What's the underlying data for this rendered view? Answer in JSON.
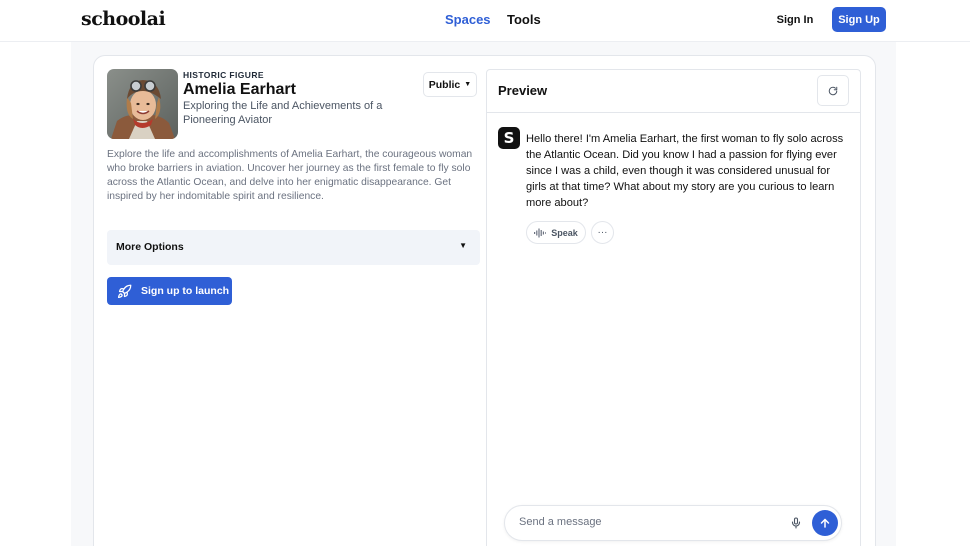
{
  "header": {
    "logo": "schoolai",
    "nav": {
      "spaces": "Spaces",
      "tools": "Tools"
    },
    "sign_in": "Sign In",
    "sign_up": "Sign Up"
  },
  "space": {
    "kicker": "HISTORIC FIGURE",
    "title": "Amelia Earhart",
    "subtitle": "Exploring the Life and Achievements of a Pioneering Aviator",
    "visibility": "Public",
    "description": "Explore the life and accomplishments of Amelia Earhart, the courageous woman who broke barriers in aviation. Uncover her journey as the first female to fly solo across the Atlantic Ocean, and delve into her enigmatic disappearance. Get inspired by her indomitable spirit and resilience.",
    "more_options": "More Options",
    "launch": "Sign up to launch"
  },
  "preview": {
    "title": "Preview",
    "bot_initial": "S",
    "message": "Hello there! I'm Amelia Earhart, the first woman to fly solo across the Atlantic Ocean. Did you know I had a passion for flying ever since I was a child, even though it was considered unusual for girls at that time? What about my story are you curious to learn more about?",
    "speak": "Speak",
    "more_actions": "···",
    "input_placeholder": "Send a message"
  },
  "icons": [
    "rocket-icon",
    "refresh-icon",
    "audio-wave-icon",
    "microphone-icon",
    "arrow-up-icon",
    "chevron-down-icon"
  ],
  "colors": {
    "accent": "#2f5fd6",
    "panel_bg": "#f1f4f9"
  }
}
